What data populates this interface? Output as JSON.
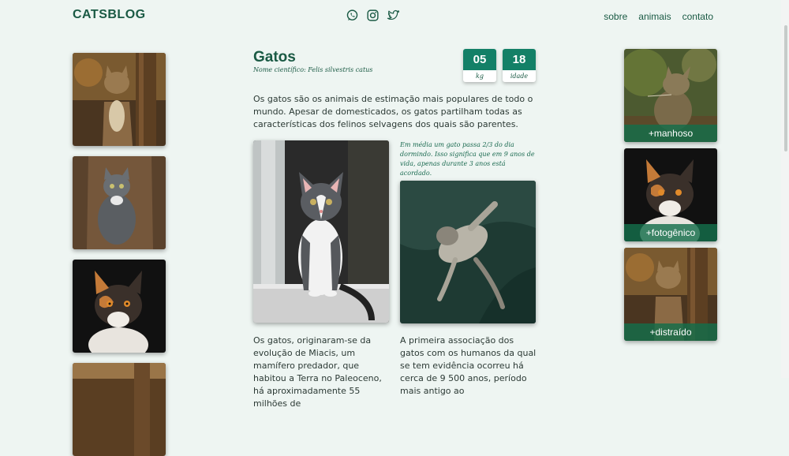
{
  "header": {
    "brand": "CATSBLOG",
    "social": [
      "whatsapp-icon",
      "instagram-icon",
      "twitter-icon"
    ],
    "nav": [
      "sobre",
      "animais",
      "contato"
    ]
  },
  "article": {
    "title": "Gatos",
    "scientific_name": "Nome científico: Felis silvestris catus",
    "stats": [
      {
        "value": "05",
        "unit": "kg"
      },
      {
        "value": "18",
        "unit": "idade"
      }
    ],
    "intro": "Os gatos são os animais de estimação mais populares de todo o mundo. Apesar de domesticados, os gatos partilham todas as características dos felinos selvagens dos quais são parentes.",
    "note": "Em média um gato passa 2/3 do dia dormindo. Isso significa que em 9 anos de vida, apenas durante 3 anos está acordado.",
    "para_left": "Os gatos, originaram-se da evolução de Miacis, um mamífero predador, que habitou a Terra no Paleoceno, há aproximadamente 55 milhões de",
    "para_right": "A primeira associação dos gatos com os humanos da qual se tem evidência ocorreu há cerca de 9 500 anos, período mais antigo ao"
  },
  "right_tiles": [
    {
      "caption": "+manhoso"
    },
    {
      "caption": "+fotogênico"
    },
    {
      "caption": "+distraído"
    }
  ],
  "colors": {
    "background": "#eef5f2",
    "brand": "#1a5a44",
    "accent": "#138067"
  }
}
